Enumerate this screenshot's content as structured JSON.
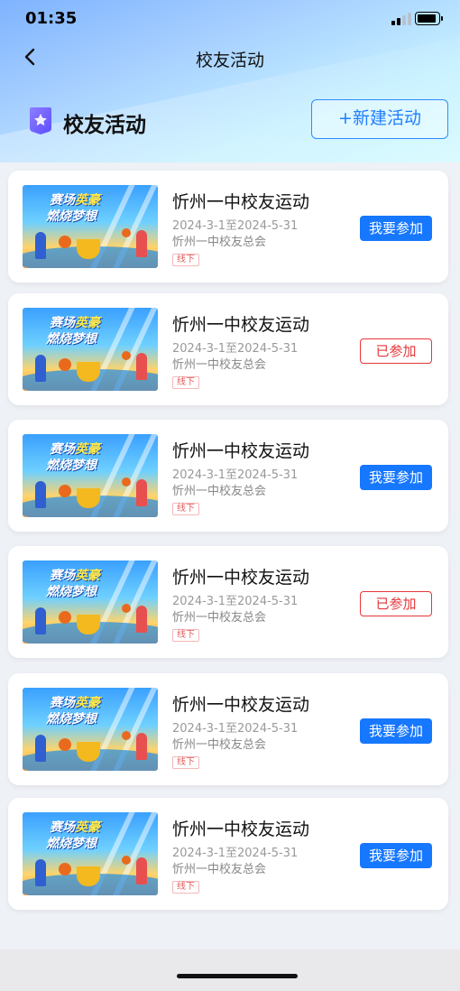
{
  "status_bar": {
    "time": "01:35"
  },
  "nav": {
    "title": "校友活动"
  },
  "section": {
    "title": "校友活动",
    "new_button": "+新建活动"
  },
  "activities": [
    {
      "title": "忻州一中校友运动",
      "date": "2024-3-1至2024-5-31",
      "organizer": "忻州一中校友总会",
      "tag": "线下",
      "action": "我要参加",
      "joined": false
    },
    {
      "title": "忻州一中校友运动",
      "date": "2024-3-1至2024-5-31",
      "organizer": "忻州一中校友总会",
      "tag": "线下",
      "action": "已参加",
      "joined": true
    },
    {
      "title": "忻州一中校友运动",
      "date": "2024-3-1至2024-5-31",
      "organizer": "忻州一中校友总会",
      "tag": "线下",
      "action": "我要参加",
      "joined": false
    },
    {
      "title": "忻州一中校友运动",
      "date": "2024-3-1至2024-5-31",
      "organizer": "忻州一中校友总会",
      "tag": "线下",
      "action": "已参加",
      "joined": true
    },
    {
      "title": "忻州一中校友运动",
      "date": "2024-3-1至2024-5-31",
      "organizer": "忻州一中校友总会",
      "tag": "线下",
      "action": "我要参加",
      "joined": false
    },
    {
      "title": "忻州一中校友运动",
      "date": "2024-3-1至2024-5-31",
      "organizer": "忻州一中校友总会",
      "tag": "线下",
      "action": "我要参加",
      "joined": false
    }
  ],
  "banner": {
    "line1a": "赛场",
    "line1b": "英豪",
    "line2": "燃烧梦想"
  },
  "colors": {
    "primary": "#1677ff",
    "joined": "#e5363a",
    "tag": "#e25b5b"
  },
  "icons": {
    "back": "chevron-left-icon",
    "section": "star-badge-icon"
  }
}
